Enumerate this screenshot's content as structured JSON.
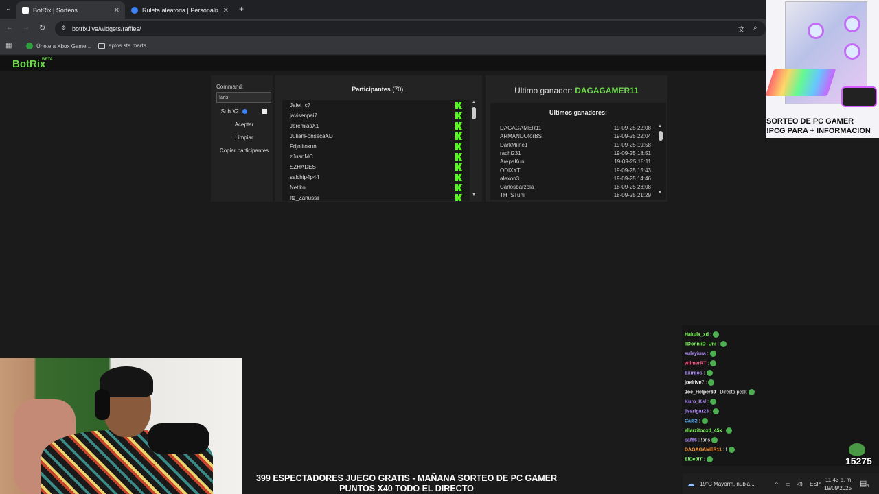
{
  "browser": {
    "tabs": [
      {
        "title": "BotRix | Sorteos",
        "active": true
      },
      {
        "title": "Ruleta aleatoria | Personaliza y",
        "active": false
      }
    ],
    "url": "botrix.live/widgets/raffles/",
    "bookmarks": [
      "Únete a Xbox Game...",
      "aptos sta marta"
    ]
  },
  "site": {
    "logo": "BotRix",
    "badge": "BETA"
  },
  "controls": {
    "command_label": "Command:",
    "command_value": "!aris",
    "subx2_label": "Sub X2",
    "accept": "Aceptar",
    "clear": "Limpiar",
    "copy": "Copiar participantes"
  },
  "participants": {
    "title": "Participantes",
    "count": "(70):",
    "items": [
      "Jafet_c7",
      "javisenpai7",
      "JeremiasX1",
      "JulianFonsecaXD",
      "Frijolitokun",
      "zJuanMC",
      "SZHADES",
      "salchip4p44",
      "Netiko",
      "Itz_Zanussii"
    ]
  },
  "winner": {
    "label": "Ultimo ganador:",
    "name": "DAGAGAMER11",
    "history_title": "Ultimos ganadores:",
    "history": [
      {
        "name": "DAGAGAMER11",
        "date": "19-09-25 22:08"
      },
      {
        "name": "ARMANDOforBS",
        "date": "19-09-25 22:04"
      },
      {
        "name": "DarkMiine1",
        "date": "19-09-25 19:58"
      },
      {
        "name": "rachi231",
        "date": "19-09-25 18:51"
      },
      {
        "name": "ArepaKun",
        "date": "19-09-25 18:11"
      },
      {
        "name": "ODIXYT",
        "date": "19-09-25 15:43"
      },
      {
        "name": "alexon3",
        "date": "19-09-25 14:46"
      },
      {
        "name": "Carlosbarzola",
        "date": "18-09-25 23:08"
      },
      {
        "name": "TH_STuni",
        "date": "18-09-25 21:29"
      }
    ]
  },
  "ad": {
    "line1": "SORTEO DE PC GAMER",
    "line2": "!PCG PARA + INFORMACION"
  },
  "chat": [
    {
      "user": "Hakula_xd",
      "text": ":",
      "color": "#7fff5a"
    },
    {
      "user": "IIDonniiD_Uni",
      "text": ":",
      "color": "#7fff5a"
    },
    {
      "user": "suleyiura",
      "text": ":",
      "color": "#b18cff"
    },
    {
      "user": "wilmerRT",
      "text": ":",
      "color": "#ff5a8a"
    },
    {
      "user": "Exirgos",
      "text": ":",
      "color": "#b18cff"
    },
    {
      "user": "joelrive7",
      "text": ":",
      "color": "#ffffff"
    },
    {
      "user": "Joe_Helper69",
      "text": ": Directo peak",
      "color": "#ffffff"
    },
    {
      "user": "Kuro_Ksl",
      "text": ":",
      "color": "#b18cff"
    },
    {
      "user": "jisarigar23",
      "text": ":",
      "color": "#b18cff"
    },
    {
      "user": "Cai82",
      "text": ":",
      "color": "#5ab4ff"
    },
    {
      "user": "eliarzitooxd_45x",
      "text": ":",
      "color": "#7fff5a"
    },
    {
      "user": "saf86",
      "text": ": !aris",
      "color": "#b18cff"
    },
    {
      "user": "DAGAGAMER11",
      "text": ": f",
      "color": "#ff9a3a"
    },
    {
      "user": "ElDeJiT",
      "text": ":",
      "color": "#7fff5a"
    }
  ],
  "viewer_count": "15275",
  "banner": {
    "line1": "399 ESPECTADORES JUEGO GRATIS - MAÑANA SORTEO DE PC GAMER",
    "line2": "PUNTOS X40 TODO EL DIRECTO"
  },
  "taskbar": {
    "weather": "19°C  Mayorm. nubla...",
    "lang": "ESP",
    "time": "11:43 p. m.",
    "date": "19/09/2025",
    "notif": "4"
  }
}
